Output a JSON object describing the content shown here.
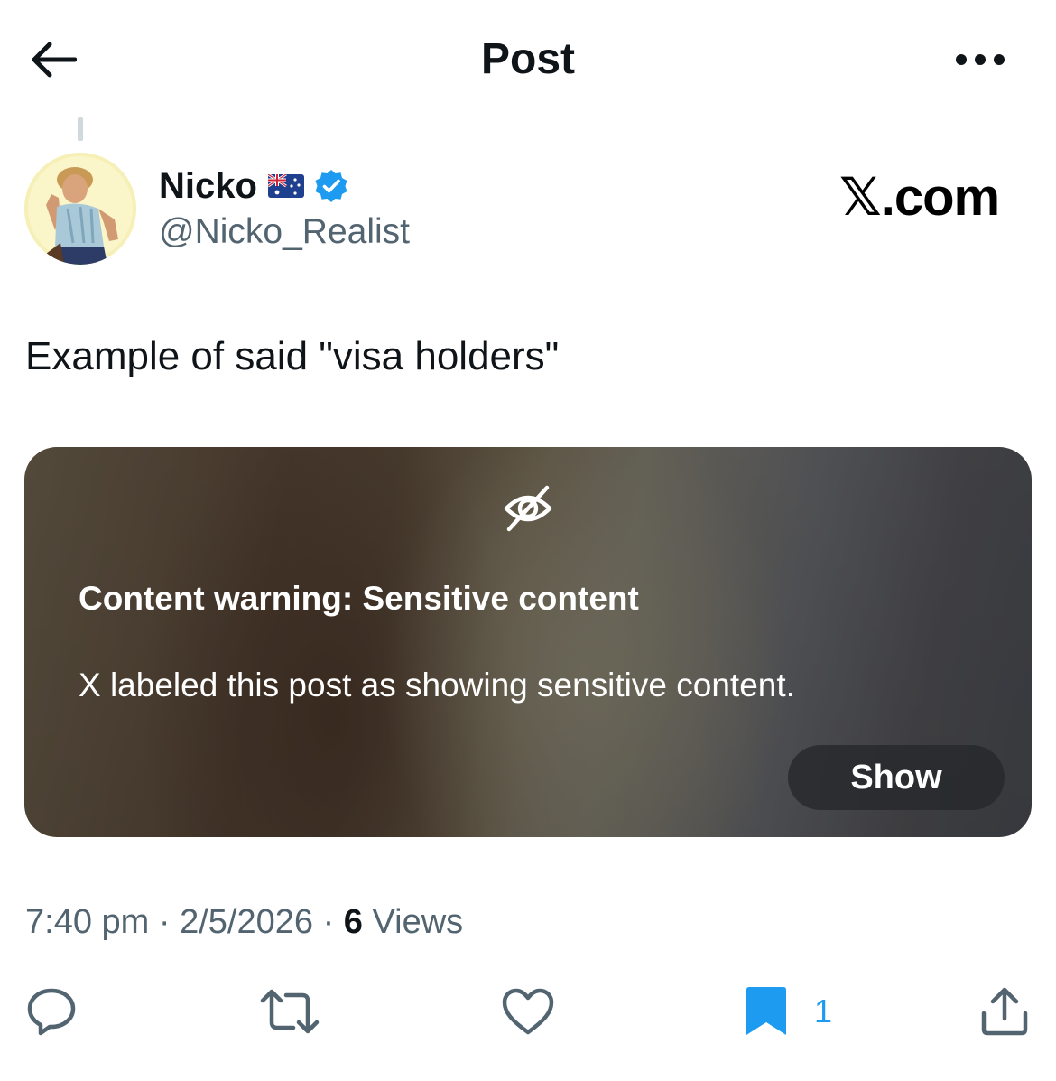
{
  "header": {
    "title": "Post",
    "back_icon": "arrow-left-icon",
    "more_icon": "more-horizontal-icon"
  },
  "author": {
    "name": "Nicko",
    "flag": "australia-flag-icon",
    "verified_icon": "verified-badge-icon",
    "handle": "@Nicko_Realist"
  },
  "brand": {
    "text": "𝕏.com"
  },
  "post": {
    "text": "Example of said \"visa holders\""
  },
  "warning": {
    "icon": "eye-off-icon",
    "title": "Content warning: Sensitive content",
    "description": "X labeled this post as showing sensitive content.",
    "show_label": "Show"
  },
  "meta": {
    "time": "7:40 pm",
    "separator": "·",
    "date": "2/5/2026",
    "views_count": "6",
    "views_label": "Views"
  },
  "actions": {
    "reply_icon": "reply-icon",
    "repost_icon": "repost-icon",
    "like_icon": "heart-icon",
    "bookmark_icon": "bookmark-icon",
    "bookmark_count": "1",
    "share_icon": "share-icon"
  },
  "colors": {
    "text": "#0f1419",
    "secondary": "#536471",
    "accent": "#1d9bf0",
    "verified": "#1d9bf0"
  }
}
